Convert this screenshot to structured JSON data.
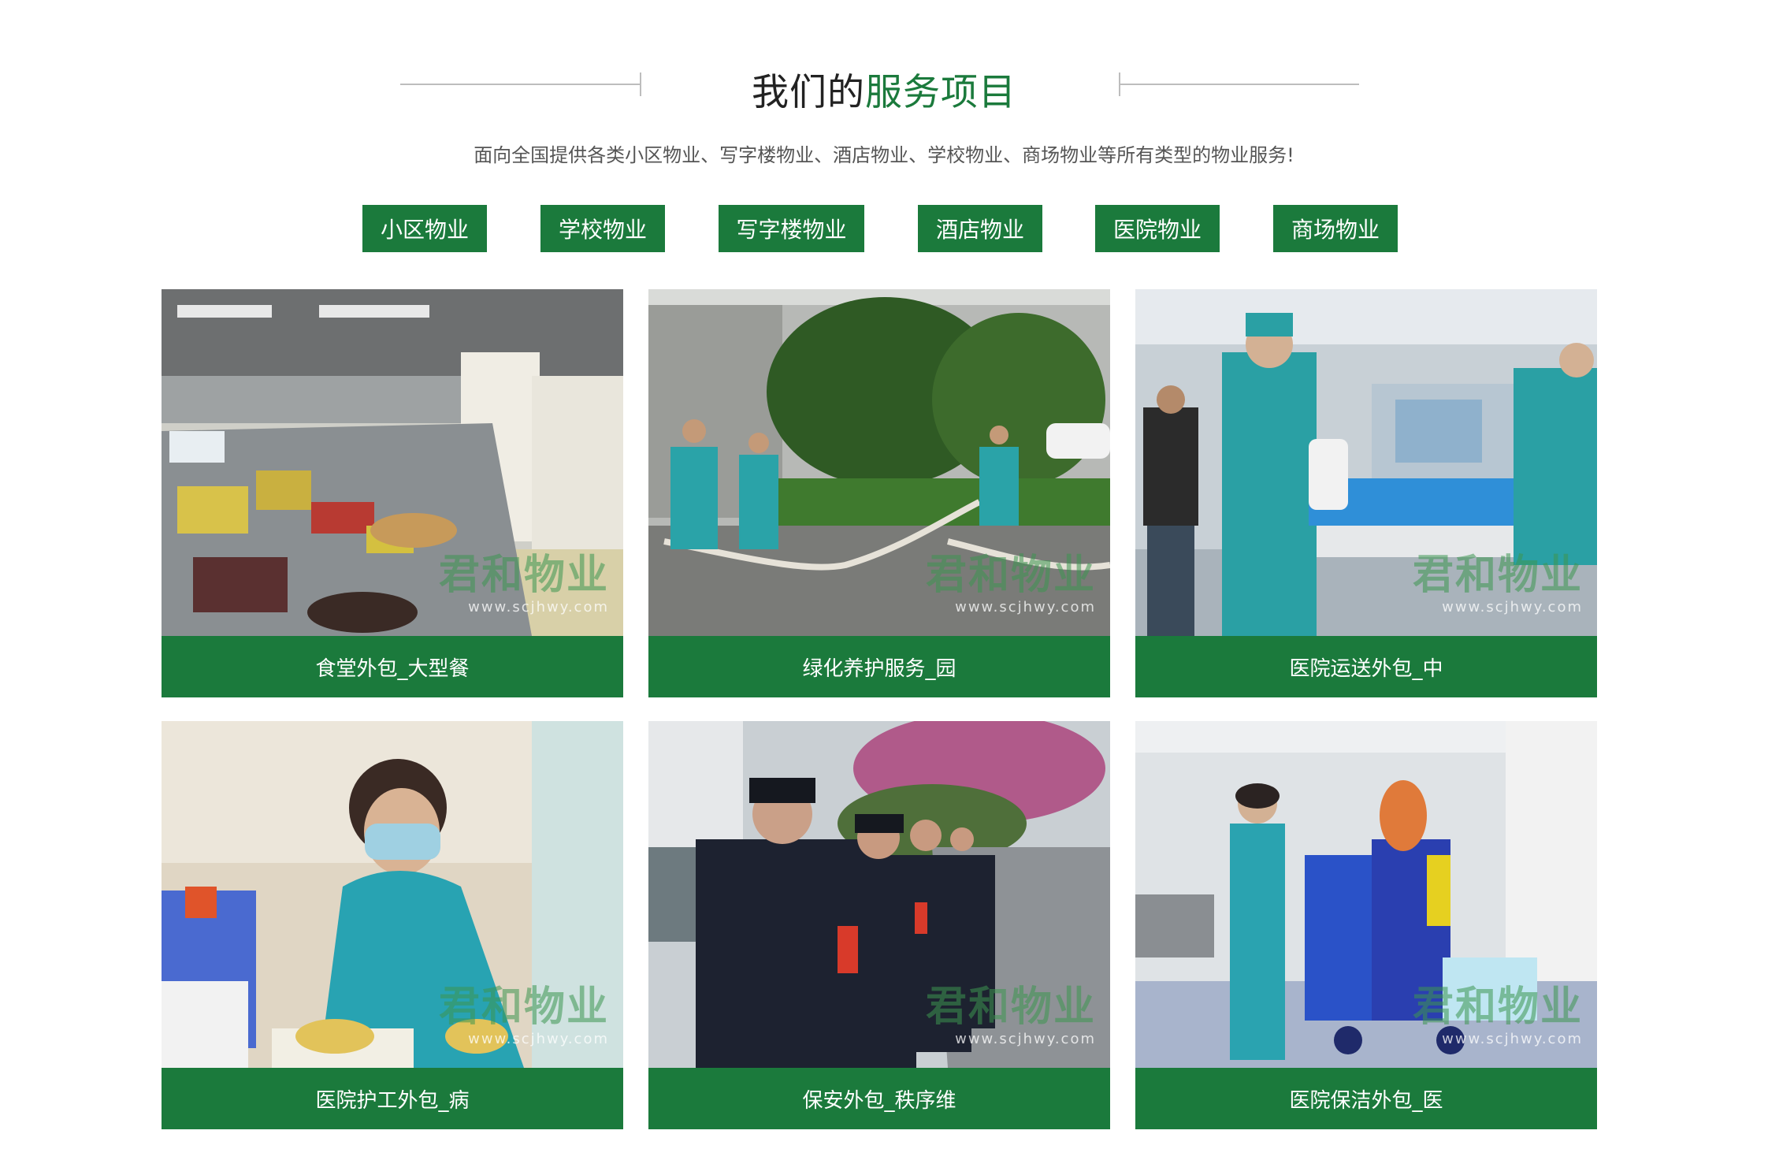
{
  "header": {
    "title_prefix": "我们的",
    "title_accent": "服务项目",
    "subtitle": "面向全国提供各类小区物业、写字楼物业、酒店物业、学校物业、商场物业等所有类型的物业服务!"
  },
  "tabs": [
    {
      "label": "小区物业"
    },
    {
      "label": "学校物业"
    },
    {
      "label": "写字楼物业"
    },
    {
      "label": "酒店物业"
    },
    {
      "label": "医院物业"
    },
    {
      "label": "商场物业"
    }
  ],
  "watermark": {
    "brand": "君和物业",
    "url": "www.scjhwy.com"
  },
  "cards": [
    {
      "caption": "食堂外包_大型餐",
      "image": "canteen-kitchen"
    },
    {
      "caption": "绿化养护服务_园",
      "image": "gardeners-watering"
    },
    {
      "caption": "医院运送外包_中",
      "image": "hospital-stretcher"
    },
    {
      "caption": "医院护工外包_病",
      "image": "nurse-worker-cleaning"
    },
    {
      "caption": "保安外包_秩序维",
      "image": "security-guards-lineup"
    },
    {
      "caption": "医院保洁外包_医",
      "image": "hospital-cleaner-cart"
    }
  ],
  "colors": {
    "brand_green": "#1b7a3c",
    "heading_text": "#222222",
    "subtitle_text": "#555555"
  }
}
